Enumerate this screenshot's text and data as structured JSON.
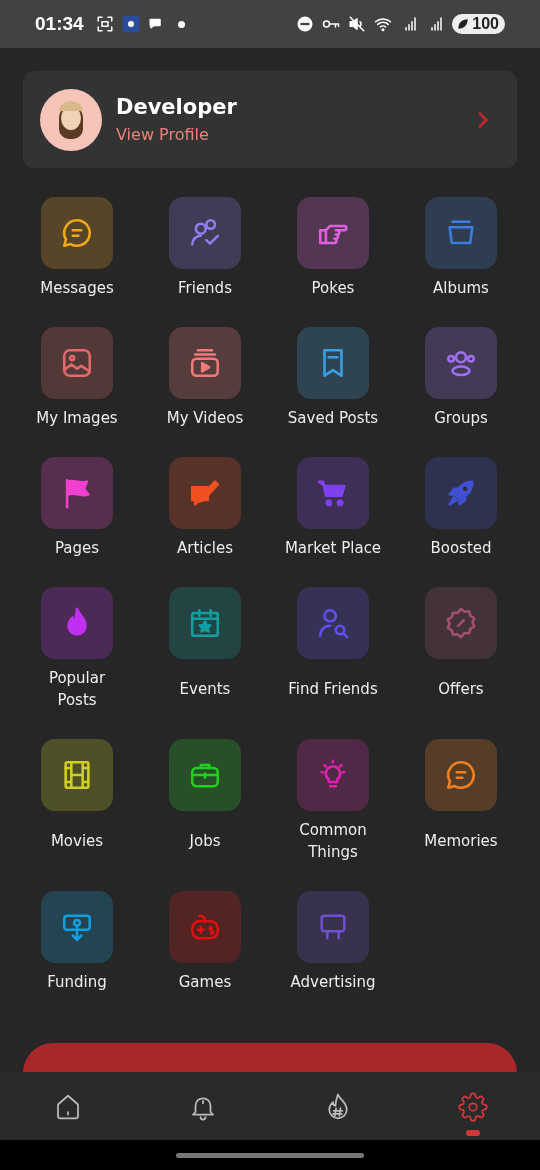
{
  "status_bar": {
    "time": "01:34",
    "battery": "100"
  },
  "profile": {
    "name": "Developer",
    "link": "View Profile"
  },
  "menu": [
    {
      "label": "Messages",
      "color": "#f0a81c"
    },
    {
      "label": "Friends",
      "color": "#8f7ef0"
    },
    {
      "label": "Pokes",
      "color": "#e060e0"
    },
    {
      "label": "Albums",
      "color": "#3a7fe0"
    },
    {
      "label": "My Images",
      "color": "#e36a6a"
    },
    {
      "label": "My Videos",
      "color": "#f07a7a"
    },
    {
      "label": "Saved Posts",
      "color": "#3aa0e0"
    },
    {
      "label": "Groups",
      "color": "#a070f0"
    },
    {
      "label": "Pages",
      "color": "#f040d0"
    },
    {
      "label": "Articles",
      "color": "#f05020"
    },
    {
      "label": "Market Place",
      "color": "#8040f0"
    },
    {
      "label": "Boosted",
      "color": "#4050d0"
    },
    {
      "label": "Popular Posts",
      "color": "#c030f0"
    },
    {
      "label": "Events",
      "color": "#10a0a0"
    },
    {
      "label": "Find Friends",
      "color": "#6050f0"
    },
    {
      "label": "Offers",
      "color": "#a05070"
    },
    {
      "label": "Movies",
      "color": "#d0d020"
    },
    {
      "label": "Jobs",
      "color": "#20d020"
    },
    {
      "label": "Common Things",
      "color": "#e020b0"
    },
    {
      "label": "Memories",
      "color": "#f08020"
    },
    {
      "label": "Funding",
      "color": "#10a0e0"
    },
    {
      "label": "Games",
      "color": "#e01010"
    },
    {
      "label": "Advertising",
      "color": "#7050d0"
    }
  ],
  "bottom_nav": [
    {
      "selected": false
    },
    {
      "selected": false
    },
    {
      "selected": false
    },
    {
      "selected": true
    }
  ]
}
